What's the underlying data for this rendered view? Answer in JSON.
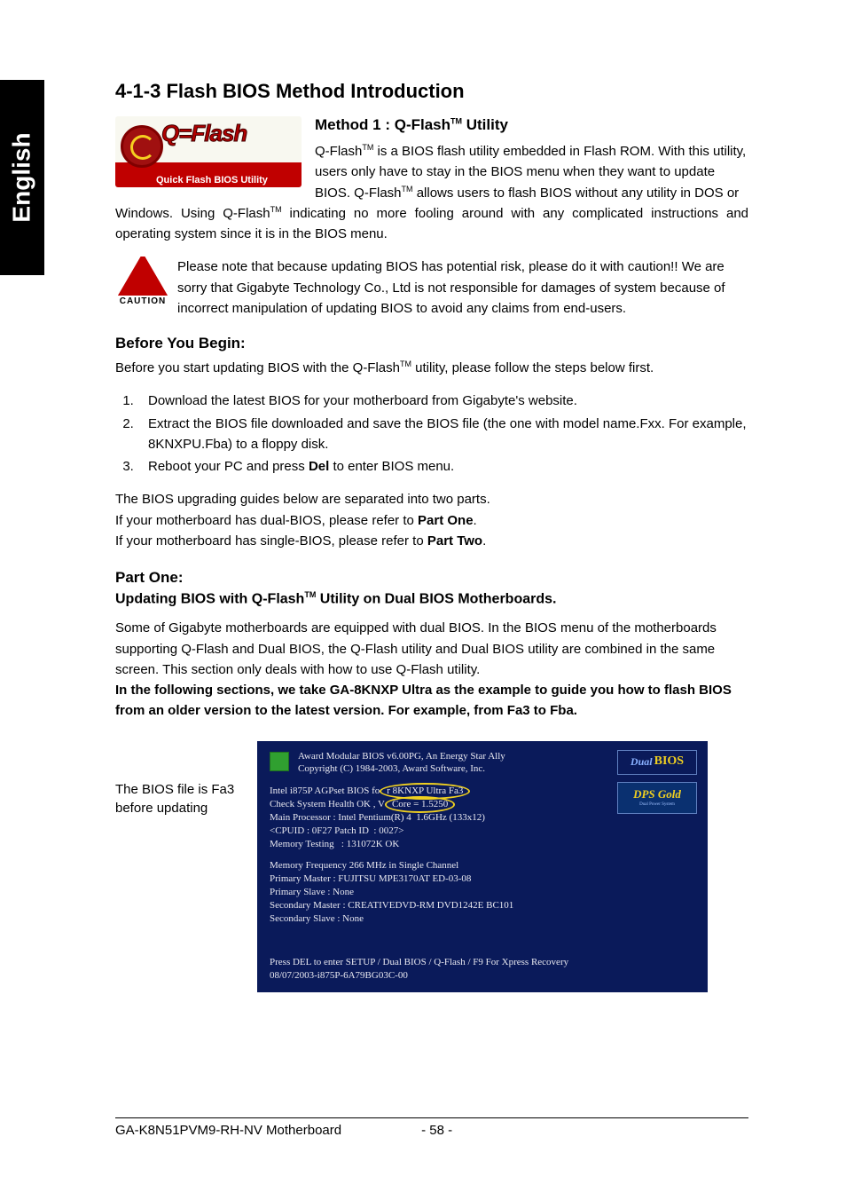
{
  "side_tab": "English",
  "section_title": "4-1-3   Flash BIOS Method Introduction",
  "qflash_logo": {
    "main": "Q=Flash",
    "sub": "Quick Flash BIOS Utility"
  },
  "method1": {
    "heading_prefix": "Method 1 : Q-Flash",
    "heading_suffix": " Utility",
    "para1_a": "Q-Flash",
    "para1_b": " is a BIOS flash utility embedded in Flash ROM. With this utility, users only have to stay in the BIOS menu when they want to update BIOS. Q-Flash",
    "para1_c": " allows users to flash BIOS without any utility in DOS or ",
    "para2_a": "Windows. Using Q-Flash",
    "para2_b": " indicating no more fooling around with any complicated instructions and operating system since it is in the BIOS menu."
  },
  "tm": "TM",
  "caution": {
    "label": "CAUTION",
    "text": "Please note that because updating BIOS has potential risk, please do it with caution!! We are sorry that Gigabyte Technology Co., Ltd is not responsible for damages of system because of incorrect manipulation of updating BIOS to avoid any claims from end-users."
  },
  "before": {
    "heading": "Before You Begin:",
    "intro_a": "Before you start updating BIOS with the Q-Flash",
    "intro_b": " utility, please follow the steps below first.",
    "steps": [
      "Download the latest BIOS for your motherboard from Gigabyte's website.",
      "Extract the BIOS file downloaded and save the BIOS file (the one with model name.Fxx. For example, 8KNXPU.Fba) to a floppy disk.",
      "Reboot your PC and press Del to enter BIOS menu."
    ],
    "step3_prefix": "Reboot your PC and press ",
    "step3_bold": "Del",
    "step3_suffix": " to enter BIOS menu."
  },
  "guides": {
    "line1": "The BIOS upgrading guides below are separated into two parts.",
    "line2_a": "If your motherboard has dual-BIOS, please refer to ",
    "line2_b": "Part One",
    "line2_c": ".",
    "line3_a": "If your motherboard has single-BIOS, please refer to ",
    "line3_b": "Part Two",
    "line3_c": "."
  },
  "part_one": {
    "heading": "Part One:",
    "sub_a": "Updating BIOS with Q-Flash",
    "sub_b": " Utility on Dual BIOS Motherboards.",
    "para": "Some of Gigabyte motherboards are equipped with dual BIOS. In the BIOS menu of the motherboards supporting Q-Flash and Dual BIOS, the Q-Flash utility and Dual BIOS utility are combined in the same screen. This section only deals with how to use Q-Flash utility.",
    "bold": "In the following sections, we take GA-8KNXP Ultra as the example to guide you how to flash BIOS from an older version to the latest version. For example, from Fa3 to Fba."
  },
  "callout": "The BIOS file is Fa3 before updating",
  "bios": {
    "header1": "Award Modular BIOS v6.00PG, An Energy Star Ally",
    "header2": "Copyright  (C) 1984-2003, Award Software,  Inc.",
    "line_ag_a": "Intel i875P AGPset BIOS fo",
    "line_ag_pill": "r 8KNXP Ultra Fa3",
    "line_health_a": "Check System Health OK , V",
    "line_health_pill": "Core = 1.5250",
    "line_cpu": "Main Processor : Intel Pentium(R) 4  1.6GHz (133x12)",
    "line_cpuid": "<CPUID : 0F27 Patch ID  : 0027>",
    "line_mem": "Memory Testing   : 131072K OK",
    "line_freq": "Memory Frequency 266 MHz in Single Channel",
    "line_pm": "Primary Master : FUJITSU MPE3170AT ED-03-08",
    "line_ps": "Primary Slave : None",
    "line_sm": "Secondary Master : CREATIVEDVD-RM DVD1242E BC101",
    "line_ss": "Secondary Slave : None",
    "foot1": "Press DEL to enter SETUP / Dual BIOS / Q-Flash / F9 For Xpress Recovery",
    "foot2": "08/07/2003-i875P-6A79BG03C-00",
    "badge_dual_a": "Dual",
    "badge_dual_b": "BIOS",
    "badge_dps_a": "DPS Gold",
    "badge_dps_b": "Dual Power System"
  },
  "footer": {
    "model": "GA-K8N51PVM9-RH-NV Motherboard",
    "page": "- 58 -"
  }
}
